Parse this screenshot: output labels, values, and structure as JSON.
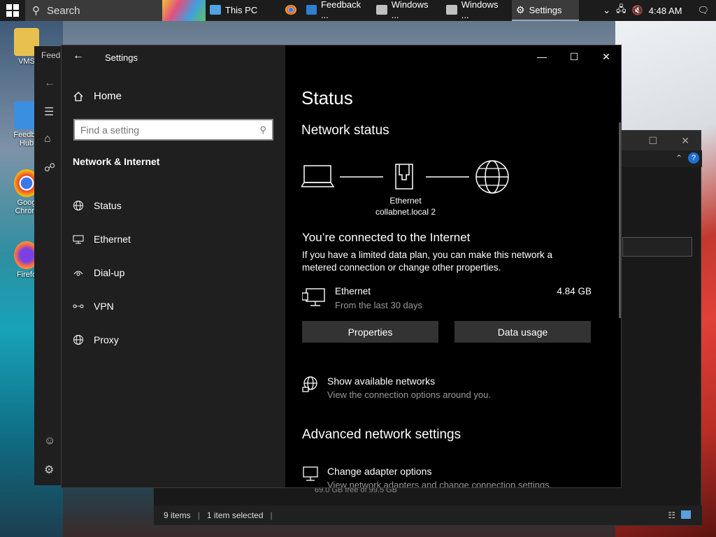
{
  "taskbar": {
    "search_label": "Search",
    "apps": [
      {
        "label": "This PC",
        "color": "#4fa3e0",
        "active": false
      },
      {
        "label": "",
        "color": "#e0a030",
        "active": false
      },
      {
        "label": "Feedback ...",
        "color": "#2d7fd2",
        "active": false
      },
      {
        "label": "Windows ...",
        "color": "#c0c0c0",
        "active": false
      },
      {
        "label": "Windows ...",
        "color": "#c0c0c0",
        "active": false
      },
      {
        "label": "Settings",
        "color": "#888888",
        "active": true
      }
    ],
    "clock": "4:48 AM"
  },
  "desktop": {
    "icons": [
      {
        "label": "VMS"
      },
      {
        "label": "Feedba Hub"
      },
      {
        "label": "Goog Chrom"
      },
      {
        "label": "Firefo"
      }
    ]
  },
  "feedback_window": {
    "title": "Feedb"
  },
  "explorer": {
    "status_items": "9 items",
    "status_selected": "1 item selected",
    "drive_text": "69.0 GB free of 99.5 GB"
  },
  "settings": {
    "title": "Settings",
    "home_label": "Home",
    "search_placeholder": "Find a setting",
    "category": "Network & Internet",
    "nav": [
      {
        "label": "Status",
        "icon": "globe-icon",
        "glyph": "🌐"
      },
      {
        "label": "Ethernet",
        "icon": "ethernet-icon",
        "glyph": "🖥"
      },
      {
        "label": "Dial-up",
        "icon": "dialup-icon",
        "glyph": "☎"
      },
      {
        "label": "VPN",
        "icon": "vpn-icon",
        "glyph": "⚯"
      },
      {
        "label": "Proxy",
        "icon": "proxy-icon",
        "glyph": "🌐"
      }
    ],
    "main": {
      "heading": "Status",
      "network_status": "Network status",
      "diagram_caption_1": "Ethernet",
      "diagram_caption_2": "collabnet.local 2",
      "connected": "You’re connected to the Internet",
      "connected_desc": "If you have a limited data plan, you can make this network a metered connection or change other properties.",
      "ethernet_name": "Ethernet",
      "ethernet_sub": "From the last 30 days",
      "ethernet_usage": "4.84 GB",
      "properties_btn": "Properties",
      "data_usage_btn": "Data usage",
      "show_networks_title": "Show available networks",
      "show_networks_sub": "View the connection options around you.",
      "advanced_heading": "Advanced network settings",
      "adapter_title": "Change adapter options",
      "adapter_sub": "View network adapters and change connection settings."
    }
  }
}
